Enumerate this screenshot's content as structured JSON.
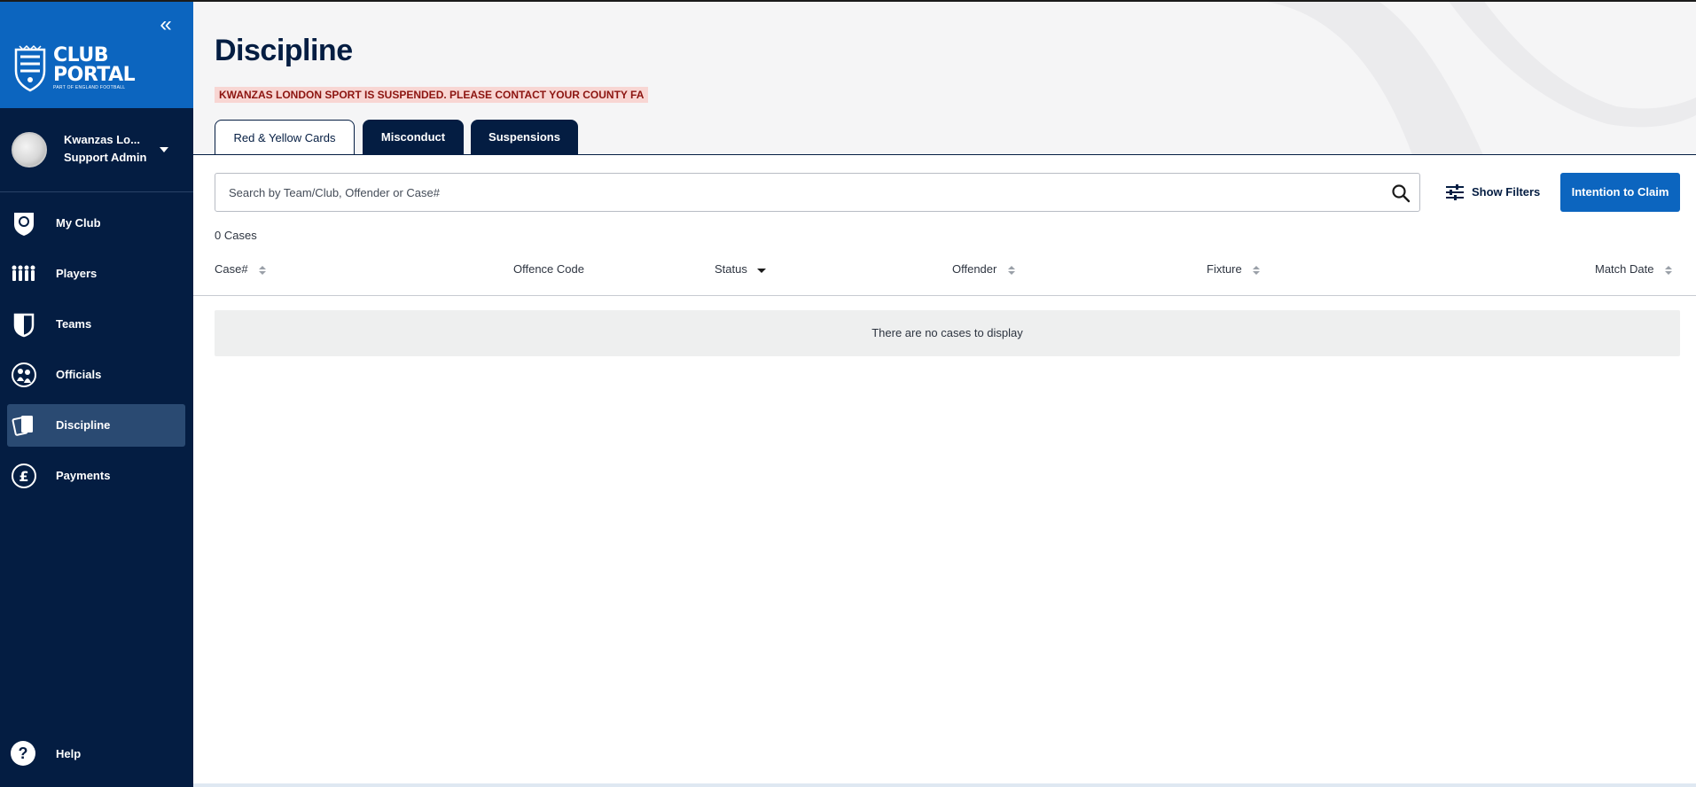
{
  "sidebar": {
    "brand": {
      "line1": "CLUB",
      "line2": "PORTAL",
      "tagline": "PART OF ENGLAND FOOTBALL"
    },
    "collapse_glyph": "«",
    "user": {
      "name": "Kwanzas Lo...",
      "role": "Support Admin"
    },
    "items": [
      {
        "label": "My Club",
        "icon": "club-badge-icon"
      },
      {
        "label": "Players",
        "icon": "players-icon"
      },
      {
        "label": "Teams",
        "icon": "teams-shield-icon"
      },
      {
        "label": "Officials",
        "icon": "officials-icon"
      },
      {
        "label": "Discipline",
        "icon": "cards-icon",
        "active": true
      },
      {
        "label": "Payments",
        "icon": "pound-icon"
      }
    ],
    "help": {
      "label": "Help",
      "glyph": "?"
    }
  },
  "page": {
    "title": "Discipline",
    "alert": "KWANZAS LONDON SPORT IS SUSPENDED. PLEASE CONTACT YOUR COUNTY FA"
  },
  "tabs": [
    {
      "label": "Red & Yellow Cards",
      "active": true
    },
    {
      "label": "Misconduct",
      "active": false
    },
    {
      "label": "Suspensions",
      "active": false
    }
  ],
  "search": {
    "placeholder": "Search by Team/Club, Offender or Case#"
  },
  "toolbar": {
    "filters_label": "Show Filters",
    "claim_label": "Intention to Claim"
  },
  "results": {
    "count_label": "0 Cases",
    "empty_message": "There are no cases to display"
  },
  "table": {
    "columns": [
      {
        "label": "Case#",
        "sort": "both"
      },
      {
        "label": "Offence Code",
        "sort": "none"
      },
      {
        "label": "Status",
        "sort": "desc"
      },
      {
        "label": "Offender",
        "sort": "both"
      },
      {
        "label": "Fixture",
        "sort": "both"
      },
      {
        "label": "Match Date",
        "sort": "both"
      }
    ]
  },
  "colors": {
    "navy": "#041d42",
    "blue": "#0c65bf",
    "alert_bg": "#f8d6d3",
    "alert_text": "#8c1410"
  }
}
